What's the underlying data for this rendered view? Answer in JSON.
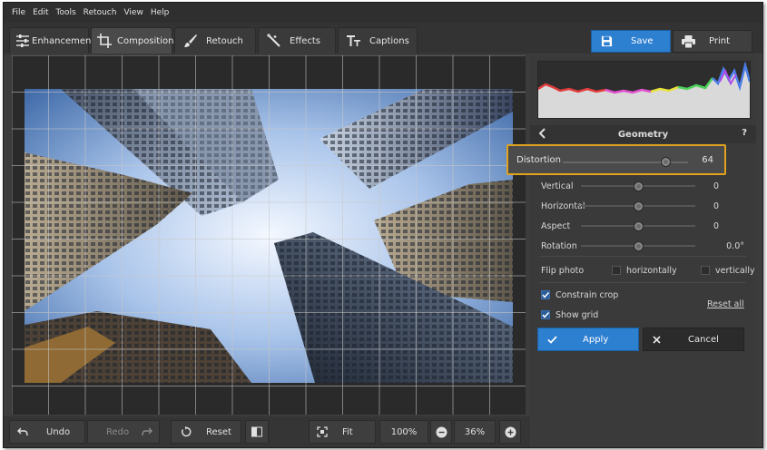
{
  "menu": [
    "File",
    "Edit",
    "Tools",
    "Retouch",
    "View",
    "Help"
  ],
  "tabs": [
    {
      "label": "Enhancement",
      "icon": "sliders-icon"
    },
    {
      "label": "Composition",
      "icon": "crop-icon"
    },
    {
      "label": "Retouch",
      "icon": "brush-icon"
    },
    {
      "label": "Effects",
      "icon": "magic-wand-icon"
    },
    {
      "label": "Captions",
      "icon": "text-icon"
    }
  ],
  "actions": {
    "save": "Save",
    "print": "Print"
  },
  "geometry": {
    "title": "Geometry",
    "help": "?",
    "distortion": {
      "label": "Distortion",
      "value": "64",
      "level": 0.82
    },
    "vertical": {
      "label": "Vertical",
      "value": "0",
      "level": 0.5
    },
    "horizontal": {
      "label": "Horizontal",
      "value": "0",
      "level": 0.5
    },
    "aspect": {
      "label": "Aspect",
      "value": "0",
      "level": 0.5
    },
    "rotation": {
      "label": "Rotation",
      "value": "0.0°",
      "level": 0.5
    },
    "flip_label": "Flip photo",
    "flip_h": "horizontally",
    "flip_v": "vertically",
    "constrain_crop": "Constrain crop",
    "show_grid": "Show grid",
    "reset_all": "Reset all",
    "apply": "Apply",
    "cancel": "Cancel"
  },
  "bottom": {
    "undo": "Undo",
    "redo": "Redo",
    "reset": "Reset",
    "fit": "Fit",
    "zoom100": "100%",
    "zoom_value": "36%"
  },
  "colors": {
    "accent": "#2d7fd0",
    "highlight": "#e0a21e"
  }
}
